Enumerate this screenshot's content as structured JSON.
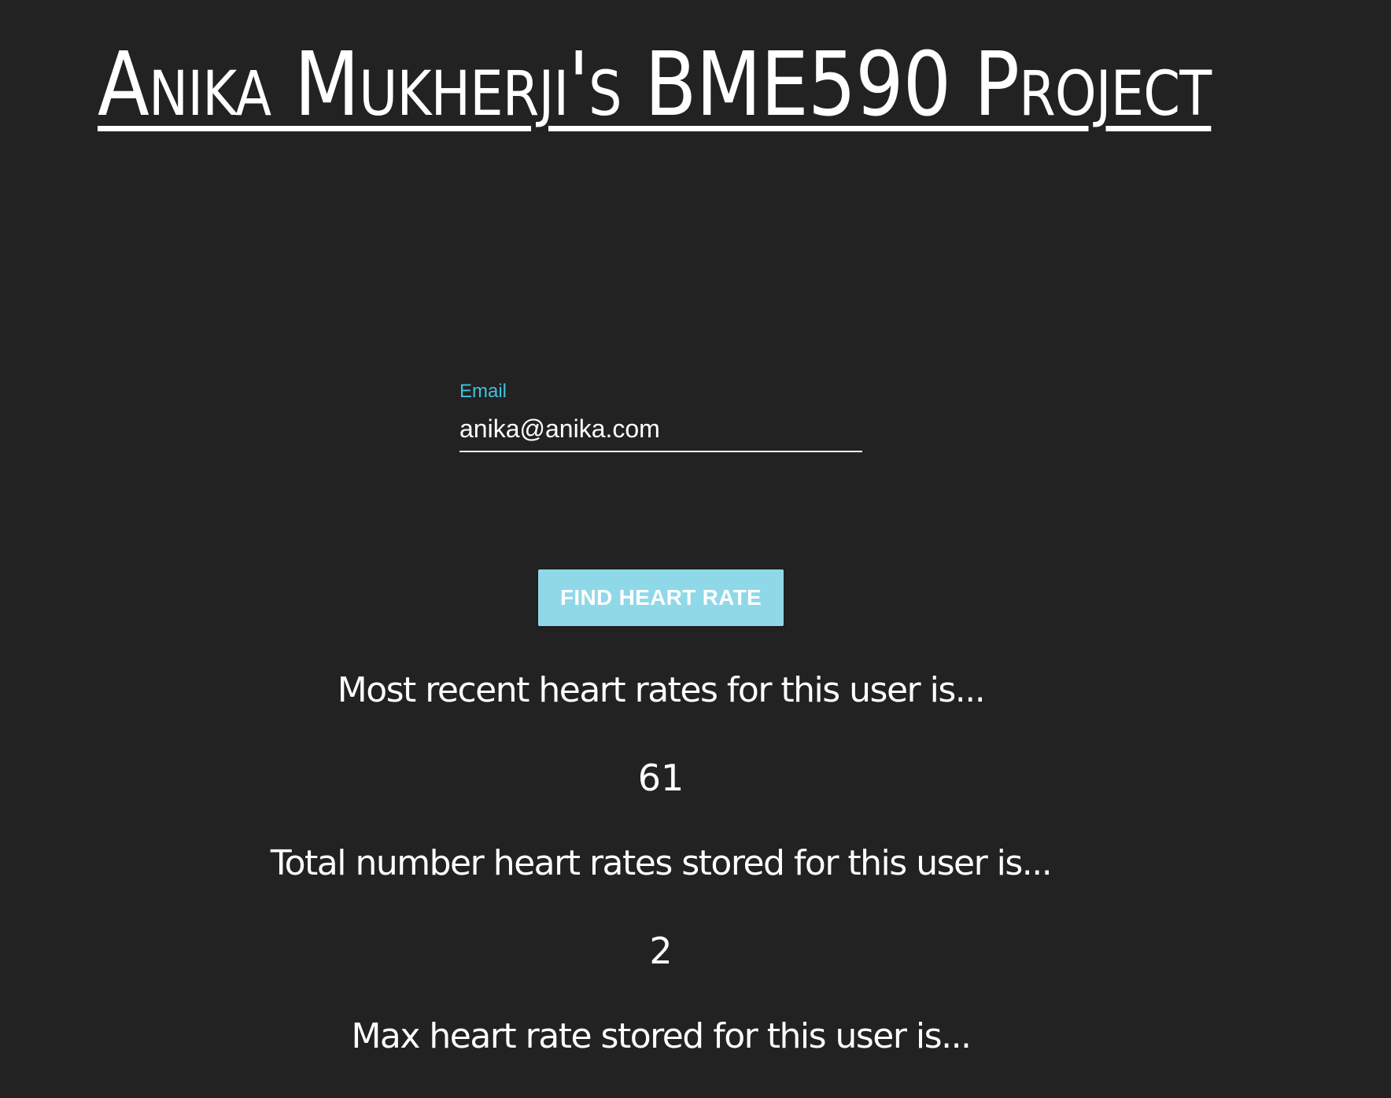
{
  "page": {
    "title": "Anika Mukherji's BME590 Project"
  },
  "form": {
    "email_label": "Email",
    "email_value": "anika@anika.com",
    "submit_label": "FIND HEART RATE"
  },
  "results": {
    "recent_label": "Most recent heart rates for this user is...",
    "recent_value": "61",
    "total_label": "Total number heart rates stored for this user is...",
    "total_value": "2",
    "max_label": "Max heart rate stored for this user is..."
  },
  "colors": {
    "background": "#222222",
    "accent": "#3fc2dd",
    "button": "#8fd8e8",
    "text": "#ffffff"
  }
}
